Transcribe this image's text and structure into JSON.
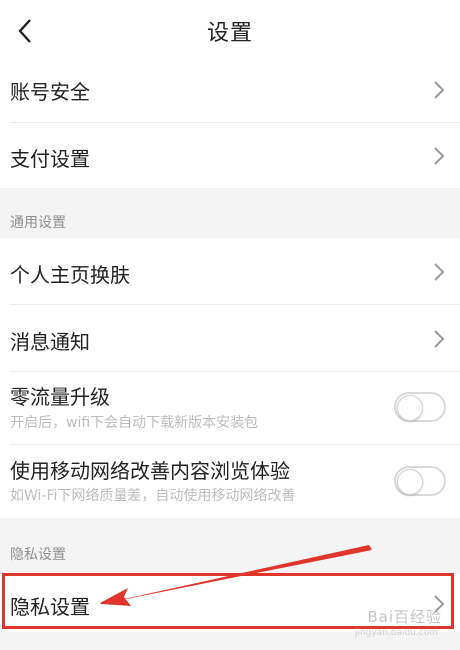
{
  "header": {
    "title": "设置"
  },
  "items": {
    "account_security": "账号安全",
    "payment_settings": "支付设置",
    "profile_skin": "个人主页换肤",
    "notifications": "消息通知",
    "zero_traffic": {
      "label": "零流量升级",
      "desc": "开启后，wifi下会自动下载新版本安装包",
      "enabled": false
    },
    "mobile_network": {
      "label": "使用移动网络改善内容浏览体验",
      "desc": "如Wi-Fi下网络质量差，自动使用移动网络改善",
      "enabled": false
    },
    "privacy_settings": "隐私设置"
  },
  "sections": {
    "general": "通用设置",
    "privacy": "隐私设置"
  },
  "watermark": {
    "text": "Bai百经验",
    "sub": "jingyan.baidu.com"
  },
  "colors": {
    "highlight": "#e0352b",
    "section_bg": "#f4f4f4"
  }
}
